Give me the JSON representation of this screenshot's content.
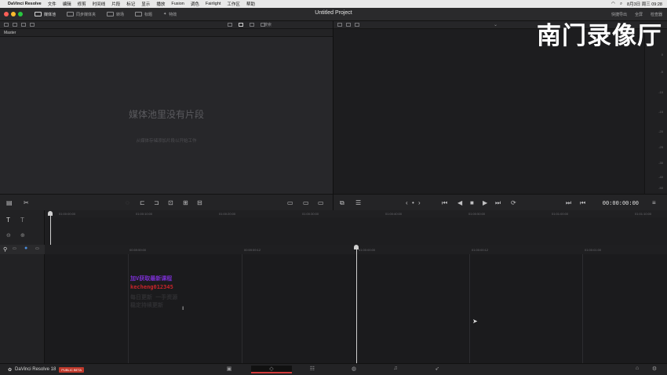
{
  "menubar": {
    "app": "DaVinci Resolve",
    "items": [
      "文件",
      "编辑",
      "修剪",
      "时间线",
      "片段",
      "标记",
      "显示",
      "播放",
      "Fusion",
      "调色",
      "Fairlight",
      "工作区",
      "帮助"
    ],
    "datetime": "8月3日 周三  09:28"
  },
  "topbar": {
    "buttons": [
      "媒体池",
      "同步媒体夹",
      "转场",
      "标题",
      "特效"
    ],
    "project_title": "Untitled Project",
    "right": [
      "快捷导出",
      "全屏",
      "检查器"
    ]
  },
  "media": {
    "search_placeholder": "搜索",
    "bin": "Master",
    "empty_title": "媒体池里没有片段",
    "empty_sub": "从媒体存储添加片段以开始工作"
  },
  "meter": {
    "ticks": [
      "0",
      "-5",
      "-10",
      "-15",
      "-20",
      "-25",
      "-30",
      "-40",
      "-50"
    ]
  },
  "viewer": {
    "timecode": "00:00:00:00"
  },
  "ruler_top": [
    "01:00:00:00",
    "01:00:10:00",
    "01:00:20:00",
    "01:00:30:00",
    "01:00:40:00",
    "01:00:50:00",
    "01:01:00:00",
    "01:01:10:00"
  ],
  "ruler_main": [
    "00:59:59:00",
    "00:59:59:12",
    "01:00:00:00",
    "01:00:00:12",
    "01:00:01:00"
  ],
  "overlay": {
    "line1": "加V获取最新课程",
    "line2": "kecheng012345",
    "line3": "每日更新 一手资源",
    "line4": "稳定持续更新"
  },
  "pages": {
    "app_name": "DaVinci Resolve 18",
    "badge": "PUBLIC BETA"
  },
  "watermark": "南门录像厅",
  "colors": {
    "accent_red": "#d03b3b",
    "light_red": "#fe5f57",
    "light_yellow": "#febb2e",
    "light_green": "#28c840",
    "overlay_purple": "#7a2fd0",
    "overlay_red": "#c8242b"
  }
}
